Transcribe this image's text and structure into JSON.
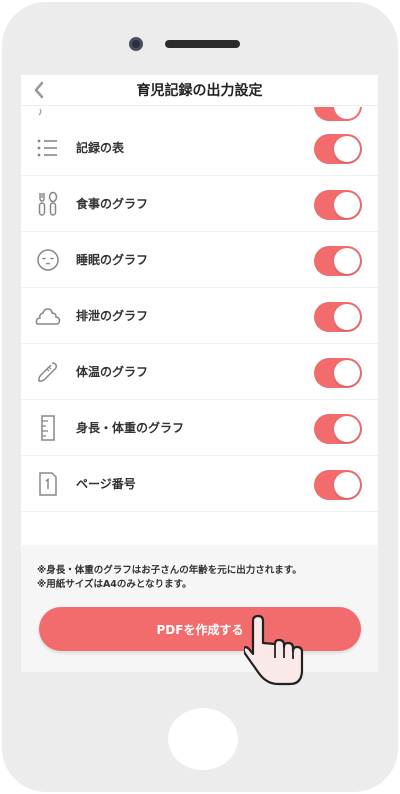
{
  "header": {
    "title": "育児記録の出力設定",
    "back_icon": "chevron-left-icon"
  },
  "rows": [
    {
      "label": "記録の表",
      "icon": "list-icon",
      "enabled": true
    },
    {
      "label": "食事のグラフ",
      "icon": "utensils-icon",
      "enabled": true
    },
    {
      "label": "睡眠のグラフ",
      "icon": "sleep-face-icon",
      "enabled": true
    },
    {
      "label": "排泄のグラフ",
      "icon": "poop-icon",
      "enabled": true
    },
    {
      "label": "体温のグラフ",
      "icon": "thermometer-icon",
      "enabled": true
    },
    {
      "label": "身長・体重のグラフ",
      "icon": "ruler-icon",
      "enabled": true
    },
    {
      "label": "ページ番号",
      "icon": "page-number-icon",
      "enabled": true
    }
  ],
  "notes": [
    "※身長・体重のグラフはお子さんの年齢を元に出力されます。",
    "※用紙サイズはA4のみとなります。"
  ],
  "pdf_button": {
    "label": "PDFを作成する"
  },
  "colors": {
    "accent": "#f26c6e",
    "background": "#ececec",
    "notes_bg": "#f6f6f6"
  }
}
